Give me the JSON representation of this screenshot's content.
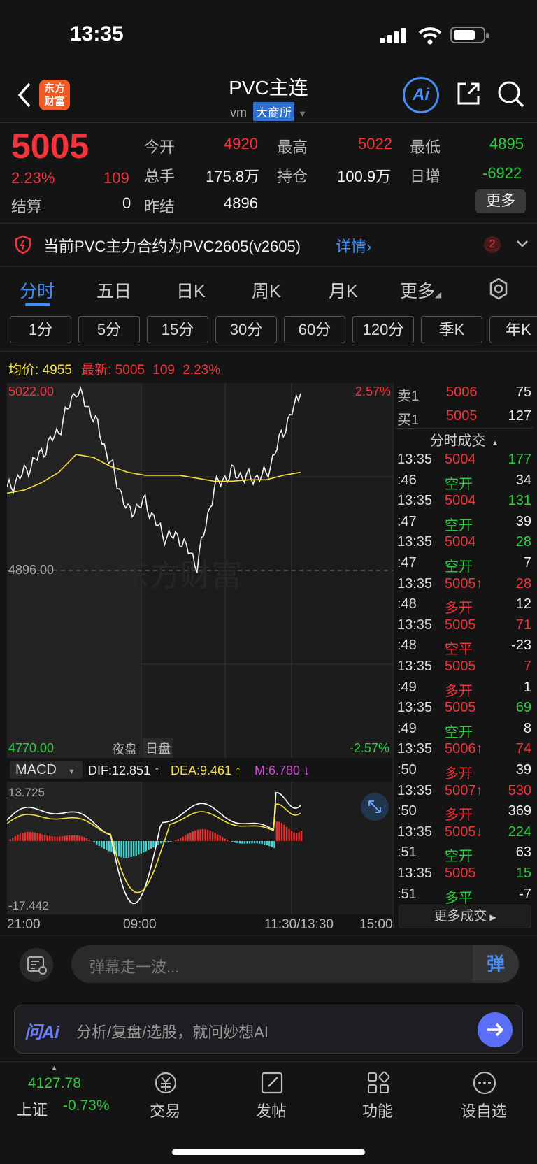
{
  "status": {
    "time": "13:35"
  },
  "header": {
    "back_label": "<",
    "logo_text_line1": "东方",
    "logo_text_line2": "财富",
    "title": "PVC主连",
    "subtitle_code": "vm",
    "exchange": "大商所",
    "ai_label": "Ai"
  },
  "quote": {
    "price": "5005",
    "change_pct": "2.23%",
    "change": "109",
    "settle_label": "结算",
    "settle_value": "0",
    "open_label": "今开",
    "open_value": "4920",
    "high_label": "最高",
    "high_value": "5022",
    "low_label": "最低",
    "low_value": "4895",
    "volume_label": "总手",
    "volume_value": "175.8万",
    "oi_label": "持仓",
    "oi_value": "100.9万",
    "daily_inc_label": "日增",
    "daily_inc_value": "-6922",
    "prev_settle_label": "昨结",
    "prev_settle_value": "4896",
    "more_label": "更多"
  },
  "notice": {
    "text": "当前PVC主力合约为PVC2605(v2605)",
    "link": "详情",
    "badge": "2"
  },
  "tabs": [
    "分时",
    "五日",
    "日K",
    "周K",
    "月K",
    "更多"
  ],
  "active_tab": 0,
  "periods": [
    "1分",
    "5分",
    "15分",
    "30分",
    "60分",
    "120分",
    "季K",
    "年K"
  ],
  "chart_header": {
    "avg_label": "均价:",
    "avg_value": "4955",
    "latest_label": "最新:",
    "latest_value": "5005",
    "latest_change": "109",
    "latest_pct": "2.23%"
  },
  "chart_labels": {
    "top_price": "5022.00",
    "mid_price": "4896.00",
    "bottom_price": "4770.00",
    "top_pct": "2.57%",
    "bottom_pct": "-2.57%",
    "night": "夜盘",
    "day": "日盘",
    "watermark": "东方财富"
  },
  "macd": {
    "selector": "MACD",
    "dif": "DIF:12.851 ↑",
    "dea": "DEA:9.461 ↑",
    "m": "M:6.780 ↓",
    "top": "13.725",
    "bottom": "-17.442"
  },
  "time_axis": [
    "21:00",
    "09:00",
    "11:30/13:30",
    "15:00"
  ],
  "chart_data": {
    "type": "line",
    "title": "",
    "xlabel": "",
    "ylabel": "",
    "ylim": [
      4770,
      5022
    ],
    "series": [
      {
        "values": [
          4950,
          4962,
          4975,
          4990,
          5018,
          5000,
          4968,
          4935,
          4942,
          4920,
          4918,
          4900,
          4952,
          4962,
          4958,
          4960,
          4990,
          5015
        ]
      },
      {
        "values": [
          4948,
          4950,
          4955,
          4962,
          4974,
          4972,
          4966,
          4962,
          4960,
          4960,
          4960,
          4958,
          4956,
          4956,
          4957,
          4957,
          4960,
          4962
        ]
      }
    ]
  },
  "orderbook": [
    {
      "label": "卖1",
      "price": "5006",
      "vol": "75"
    },
    {
      "label": "买1",
      "price": "5005",
      "vol": "127"
    }
  ],
  "ticks_title": "分时成交",
  "ticks": [
    {
      "time": "13:35",
      "price": "5004",
      "price_color": "#f4333c",
      "vol": "177",
      "vol_color": "#2ecc40"
    },
    {
      "time": ":46",
      "price": "空开",
      "price_color": "#2ecc40",
      "vol": "34",
      "vol_color": "#f0f0f0"
    },
    {
      "time": "13:35",
      "price": "5004",
      "price_color": "#f4333c",
      "vol": "131",
      "vol_color": "#2ecc40"
    },
    {
      "time": ":47",
      "price": "空开",
      "price_color": "#2ecc40",
      "vol": "39",
      "vol_color": "#f0f0f0"
    },
    {
      "time": "13:35",
      "price": "5004",
      "price_color": "#f4333c",
      "vol": "28",
      "vol_color": "#2ecc40"
    },
    {
      "time": ":47",
      "price": "空开",
      "price_color": "#2ecc40",
      "vol": "7",
      "vol_color": "#f0f0f0"
    },
    {
      "time": "13:35",
      "price": "5005↑",
      "price_color": "#f4333c",
      "vol": "28",
      "vol_color": "#f4333c"
    },
    {
      "time": ":48",
      "price": "多开",
      "price_color": "#f4333c",
      "vol": "12",
      "vol_color": "#f0f0f0"
    },
    {
      "time": "13:35",
      "price": "5005",
      "price_color": "#f4333c",
      "vol": "71",
      "vol_color": "#f4333c"
    },
    {
      "time": ":48",
      "price": "空平",
      "price_color": "#f4333c",
      "vol": "-23",
      "vol_color": "#f0f0f0"
    },
    {
      "time": "13:35",
      "price": "5005",
      "price_color": "#f4333c",
      "vol": "7",
      "vol_color": "#f4333c"
    },
    {
      "time": ":49",
      "price": "多开",
      "price_color": "#f4333c",
      "vol": "1",
      "vol_color": "#f0f0f0"
    },
    {
      "time": "13:35",
      "price": "5005",
      "price_color": "#f4333c",
      "vol": "69",
      "vol_color": "#2ecc40"
    },
    {
      "time": ":49",
      "price": "空开",
      "price_color": "#2ecc40",
      "vol": "8",
      "vol_color": "#f0f0f0"
    },
    {
      "time": "13:35",
      "price": "5006↑",
      "price_color": "#f4333c",
      "vol": "74",
      "vol_color": "#f4333c"
    },
    {
      "time": ":50",
      "price": "多开",
      "price_color": "#f4333c",
      "vol": "39",
      "vol_color": "#f0f0f0"
    },
    {
      "time": "13:35",
      "price": "5007↑",
      "price_color": "#f4333c",
      "vol": "530",
      "vol_color": "#f4333c"
    },
    {
      "time": ":50",
      "price": "多开",
      "price_color": "#f4333c",
      "vol": "369",
      "vol_color": "#f0f0f0"
    },
    {
      "time": "13:35",
      "price": "5005↓",
      "price_color": "#f4333c",
      "vol": "224",
      "vol_color": "#2ecc40"
    },
    {
      "time": ":51",
      "price": "空开",
      "price_color": "#2ecc40",
      "vol": "63",
      "vol_color": "#f0f0f0"
    },
    {
      "time": "13:35",
      "price": "5005",
      "price_color": "#f4333c",
      "vol": "15",
      "vol_color": "#2ecc40"
    },
    {
      "time": ":51",
      "price": "多平",
      "price_color": "#2ecc40",
      "vol": "-7",
      "vol_color": "#f0f0f0"
    }
  ],
  "more_trades": "更多成交",
  "danmu_placeholder": "弹幕走一波...",
  "danmu_btn": "弹",
  "ai_bar": {
    "brand": "问Ai",
    "placeholder": "分析/复盘/选股，就问妙想AI"
  },
  "bottom_nav": {
    "index_value": "4127.78",
    "index_name": "上证",
    "index_change": "-0.73%",
    "items": [
      "交易",
      "发帖",
      "功能",
      "设自选"
    ]
  },
  "colors": {
    "up": "#f4333c",
    "down": "#2ecc40",
    "accent": "#3e8ef7",
    "avg_line": "#f5e03c"
  }
}
